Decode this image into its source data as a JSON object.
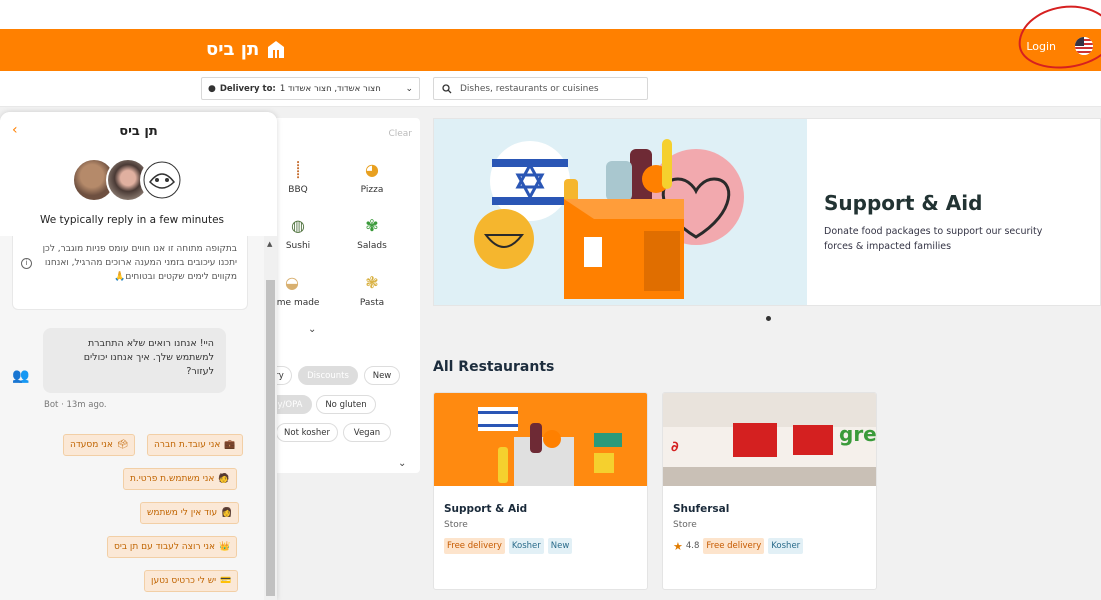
{
  "header": {
    "logo_text": "תן ביס",
    "login_label": "Login",
    "brand_color": "#ff8000"
  },
  "address": {
    "label": "Delivery to:",
    "value": "חצור אשדוד, חצור אשדוד 1"
  },
  "search": {
    "placeholder": "Dishes, restaurants or cuisines"
  },
  "categories": {
    "clear_label": "Clear",
    "items": [
      {
        "label": "BBQ",
        "icon": "skewer-icon"
      },
      {
        "label": "Pizza",
        "icon": "pizza-icon"
      },
      {
        "label": "Sushi",
        "icon": "sushi-icon"
      },
      {
        "label": "Salads",
        "icon": "salad-icon"
      },
      {
        "label": "Home made",
        "icon": "dumpling-icon"
      },
      {
        "label": "Pasta",
        "icon": "pasta-icon"
      }
    ],
    "filters": [
      "ry",
      "Discounts",
      "New",
      "y/OPA",
      "No gluten",
      "Not kosher",
      "Vegan"
    ]
  },
  "banner": {
    "title": "Support & Aid",
    "subtitle": "Donate food packages to support our security forces & impacted families"
  },
  "section_title": "All Restaurants",
  "restaurants": [
    {
      "name": "Support & Aid",
      "type": "Store",
      "tags": [
        "Free delivery",
        "Kosher",
        "New"
      ]
    },
    {
      "name": "Shufersal",
      "type": "Store",
      "rating": "4.8",
      "tags": [
        "Free delivery",
        "Kosher"
      ]
    }
  ],
  "chat": {
    "title": "תן ביס",
    "reply_time": "We typically reply in a few minutes",
    "notice": "בתקופה מתוחה זו אנו חווים עומס פניות מוגבר, לכן יתכנו עיכובים בזמני המענה ארוכים מהרגיל, ואנחנו מקווים לימים שקטים ובטוחים🙏",
    "bot_message": "היי! אנחנו רואים שלא התחברת למשתמש שלך. איך אנחנו יכולים לעזור?",
    "bot_time": "Bot · 13m ago.",
    "quick_replies": [
      "אני עובד.ת חברה",
      "אני מסעדה",
      "אני משתמש.ת פרטי.ת",
      "עוד אין לי משתמש",
      "אני רוצה לעבוד עם תן ביס",
      "יש לי כרטיס נטען"
    ]
  }
}
